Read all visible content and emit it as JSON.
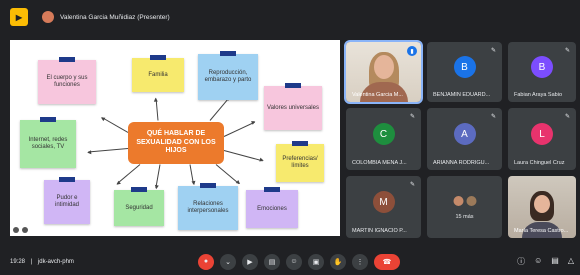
{
  "topbar": {
    "app_icon": "meet-logo-icon",
    "presenter_label": "Valentina Garcia Muñidiaz (Presenter)"
  },
  "presentation": {
    "center_title": "QUÉ HABLAR DE SEXUALIDAD CON LOS HIJOS",
    "notes": [
      "El cuerpo y sus funciones",
      "Familia",
      "Reproducción, embarazo y parto",
      "Valores universales",
      "Preferencias/ límites",
      "Internet, redes sociales, TV",
      "Pudor e intimidad",
      "Seguridad",
      "Relaciones interpersonales",
      "Emociones"
    ]
  },
  "participants": [
    {
      "name": "Valentina Garcia M...",
      "type": "video",
      "speaking": true
    },
    {
      "name": "BENJAMIN EDUARD...",
      "initial": "B",
      "color": "#1a73e8"
    },
    {
      "name": "Fabian Araya Sabio",
      "initial": "B",
      "color": "#7c4dff"
    },
    {
      "name": "COLOMBIA MENA J...",
      "initial": "C",
      "color": "#1e8e3e"
    },
    {
      "name": "ARIANNA RODRIGU...",
      "initial": "A",
      "color": "#5c6bc0"
    },
    {
      "name": "Laura Chinguel Cruz",
      "initial": "L",
      "color": "#e8336d"
    },
    {
      "name": "MARTIN IGNACIO P...",
      "initial": "M",
      "color": "#8d4f3a"
    },
    {
      "name": "15 más",
      "type": "more"
    },
    {
      "name": "María Teresa Castro...",
      "type": "video2"
    }
  ],
  "bottombar": {
    "time": "19:28",
    "separator": "|",
    "meeting_code": "jdk-avch-phm"
  },
  "colors": {
    "background": "#202124",
    "tile": "#3c4043",
    "hangup": "#ea4335",
    "center_bubble": "#ec7a2c"
  }
}
